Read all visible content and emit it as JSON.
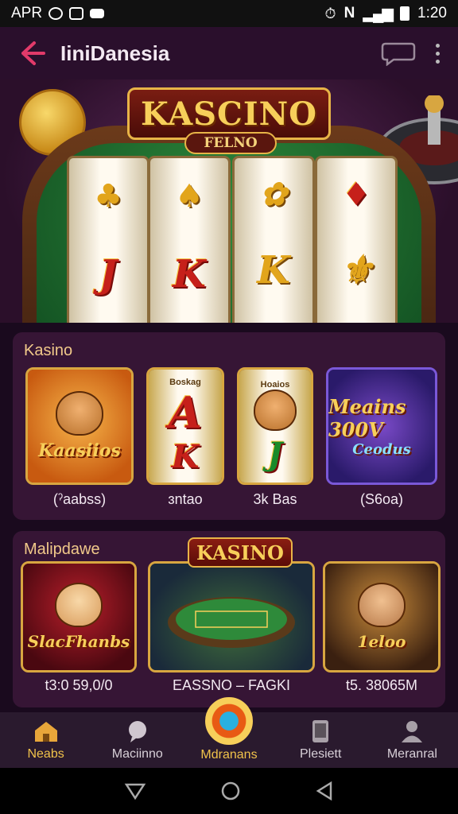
{
  "status_bar": {
    "carrier": "APR",
    "time": "1:20"
  },
  "app_bar": {
    "title": "IiniDanesia"
  },
  "hero": {
    "banner": "KASCINO",
    "sub": "FELNO"
  },
  "section1": {
    "title": "Kasino",
    "cards": [
      {
        "art": "Kaasiios",
        "label": "(ˀaabss)"
      },
      {
        "art": "Boskag",
        "label": "ɜntao"
      },
      {
        "art": "Hoaios",
        "label": "3k Bas"
      },
      {
        "art": "Meains 300V",
        "art_sub": "Ceodus",
        "label": "(S6oa)"
      }
    ]
  },
  "section2": {
    "title": "Malipdawe",
    "badge": "KASINO",
    "cards": [
      {
        "art": "SlacFhanbs",
        "label": "t3:0 59,0/0"
      },
      {
        "label": "EASSNO – FAGKI"
      },
      {
        "art": "1eloo",
        "label": "t5. 38065M"
      }
    ]
  },
  "bottom_nav": {
    "items": [
      {
        "label": "Neabs",
        "icon": "home-icon"
      },
      {
        "label": "Maciinno",
        "icon": "chat-icon"
      },
      {
        "label": "Mdranans",
        "icon": "casino-chip-icon"
      },
      {
        "label": "Plesiett",
        "icon": "phone-icon"
      },
      {
        "label": "Meranral",
        "icon": "profile-icon"
      }
    ]
  },
  "colors": {
    "accent": "#f0c24a",
    "background": "#1a0a1e",
    "app_bar": "#2a0f2c"
  }
}
